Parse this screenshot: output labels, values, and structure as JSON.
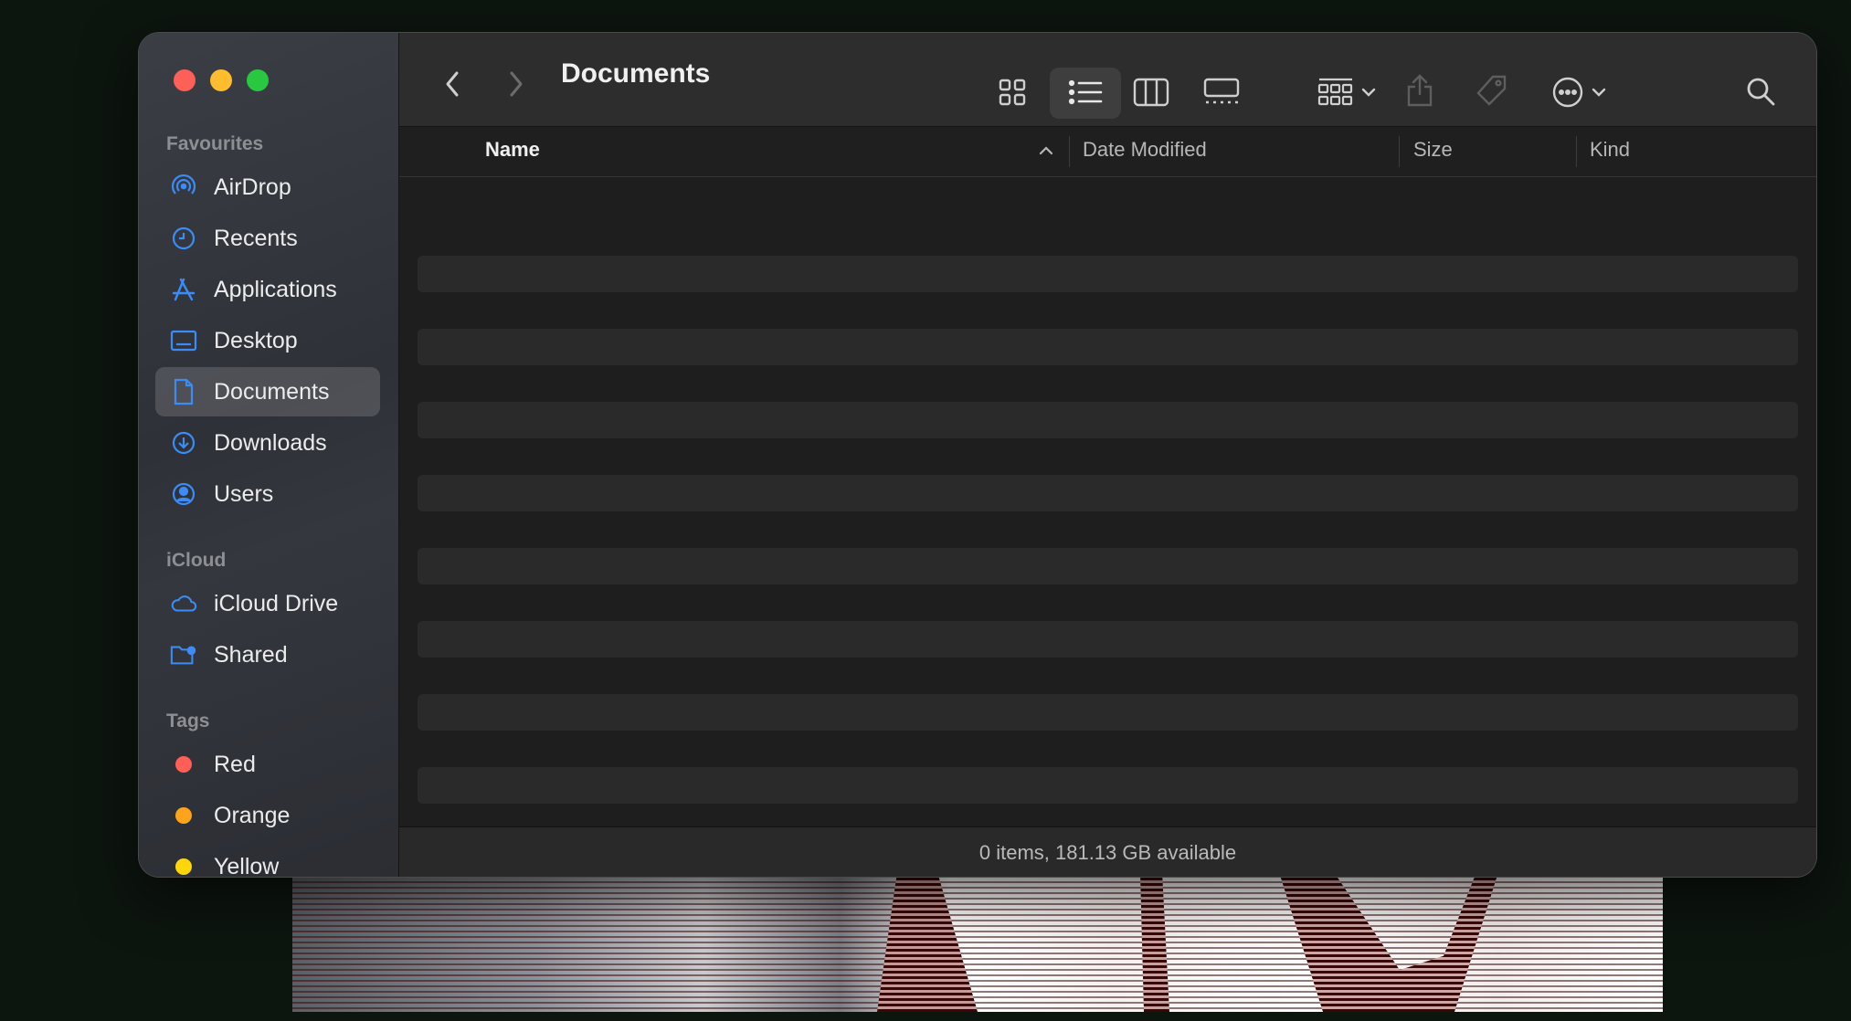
{
  "window": {
    "title": "Documents"
  },
  "sidebar": {
    "sections": [
      {
        "label": "Favourites"
      },
      {
        "label": "iCloud"
      },
      {
        "label": "Tags"
      }
    ],
    "favourites": [
      {
        "label": "AirDrop",
        "icon": "airdrop-icon"
      },
      {
        "label": "Recents",
        "icon": "clock-icon"
      },
      {
        "label": "Applications",
        "icon": "applications-icon"
      },
      {
        "label": "Desktop",
        "icon": "desktop-icon"
      },
      {
        "label": "Documents",
        "icon": "document-icon",
        "selected": true
      },
      {
        "label": "Downloads",
        "icon": "download-icon"
      },
      {
        "label": "Users",
        "icon": "user-icon"
      }
    ],
    "icloud": [
      {
        "label": "iCloud Drive",
        "icon": "cloud-icon"
      },
      {
        "label": "Shared",
        "icon": "shared-folder-icon"
      }
    ],
    "tags": [
      {
        "label": "Red",
        "color": "#ff5f57"
      },
      {
        "label": "Orange",
        "color": "#ffa31a"
      },
      {
        "label": "Yellow",
        "color": "#ffd60a"
      }
    ]
  },
  "columns": {
    "name": "Name",
    "date_modified": "Date Modified",
    "size": "Size",
    "kind": "Kind",
    "sort": "ascending"
  },
  "status": {
    "text": "0 items, 181.13 GB available"
  },
  "colors": {
    "accent": "#3b8cf6",
    "window_bg": "#1e1e1e"
  }
}
